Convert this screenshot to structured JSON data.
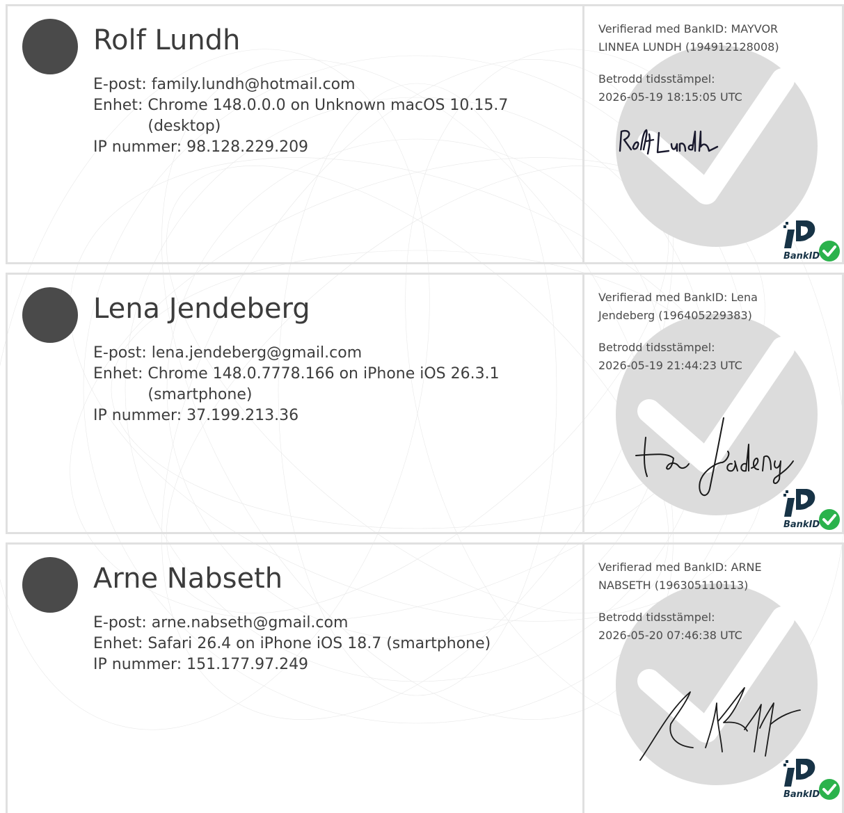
{
  "labels": {
    "email": "E-post:",
    "device": "Enhet:",
    "ip": "IP nummer:",
    "timestamp": "Betrodd tidsstämpel:",
    "bankid": "BankID"
  },
  "colors": {
    "avatar": "#4a4a4a",
    "check_circle": "#dcdcdc",
    "bankid_navy": "#173346",
    "bankid_green": "#2bb24c",
    "border": "#e0e0e0"
  },
  "signers": [
    {
      "name": "Rolf Lundh",
      "email": "family.lundh@hotmail.com",
      "device": "Chrome 148.0.0.0 on Unknown macOS 10.15.7 (desktop)",
      "ip": "98.128.229.209",
      "verified": "Verifierad med BankID: MAYVOR LINNEA LUNDH (194912128008)",
      "timestamp": "2026-05-19 18:15:05 UTC",
      "signature": "Rolf Lundh"
    },
    {
      "name": "Lena Jendeberg",
      "email": "lena.jendeberg@gmail.com",
      "device": "Chrome 148.0.7778.166 on iPhone iOS 26.3.1 (smartphone)",
      "ip": "37.199.213.36",
      "verified": "Verifierad med BankID: Lena Jendeberg (196405229383)",
      "timestamp": "2026-05-19 21:44:23 UTC",
      "signature": "Lena Jendeberg"
    },
    {
      "name": "Arne Nabseth",
      "email": "arne.nabseth@gmail.com",
      "device": "Safari 26.4 on iPhone iOS 18.7 (smartphone)",
      "ip": "151.177.97.249",
      "verified": "Verifierad med BankID: ARNE NABSETH (196305110113)",
      "timestamp": "2026-05-20 07:46:38 UTC",
      "signature": "Arne Nabseth"
    }
  ]
}
